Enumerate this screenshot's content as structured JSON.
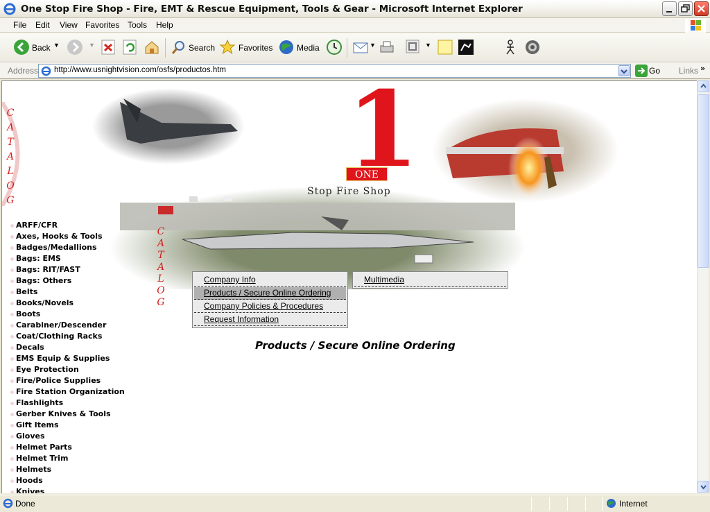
{
  "window": {
    "title": "One Stop Fire Shop - Fire, EMT & Rescue Equipment, Tools & Gear - Microsoft Internet Explorer"
  },
  "menubar": [
    "File",
    "Edit",
    "View",
    "Favorites",
    "Tools",
    "Help"
  ],
  "toolbar": {
    "back": "Back",
    "search": "Search",
    "favorites": "Favorites",
    "media": "Media"
  },
  "address": {
    "label": "Address",
    "url": "http://www.usnightvision.com/osfs/productos.htm",
    "go": "Go",
    "links": "Links"
  },
  "site": {
    "logo_number": "1",
    "logo_word": "ONE",
    "brand": "Stop Fire Shop",
    "catalog_letters": [
      "C",
      "A",
      "T",
      "A",
      "L",
      "O",
      "G"
    ],
    "nav_left": [
      {
        "label": "Company Info",
        "selected": false
      },
      {
        "label": "Products / Secure Online Ordering",
        "selected": true
      },
      {
        "label": "Company Policies & Procedures",
        "selected": false
      },
      {
        "label": "Request Information",
        "selected": false
      }
    ],
    "nav_right": [
      {
        "label": "Multimedia"
      }
    ],
    "page_title": "Products / Secure Online Ordering",
    "categories": [
      "ARFF/CFR",
      "Axes, Hooks & Tools",
      "Badges/Medallions",
      "Bags: EMS",
      "Bags: RIT/FAST",
      "Bags: Others",
      "Belts",
      "Books/Novels",
      "Boots",
      "Carabiner/Descender",
      "Coat/Clothing Racks",
      "Decals",
      "EMS Equip & Supplies",
      "Eye Protection",
      "Fire/Police Supplies",
      "Fire Station Organization",
      "Flashlights",
      "Gerber Knives & Tools",
      "Gift Items",
      "Gloves",
      "Helmet Parts",
      "Helmet Trim",
      "Helmets",
      "Hoods",
      "Knives"
    ]
  },
  "status": {
    "text": "Done",
    "zone": "Internet"
  },
  "colors": {
    "accent_red": "#d41d1d",
    "xp_blue": "#0a56d6"
  }
}
